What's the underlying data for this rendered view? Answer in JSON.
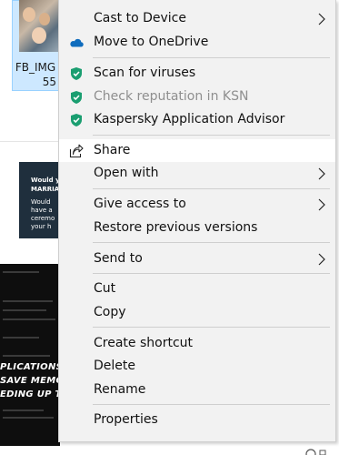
{
  "background": {
    "file1_name_line1": "FB_IMG",
    "file1_name_line2": "55",
    "thumb2_text": [
      "Would y",
      "MARRIA",
      "Would",
      "have a",
      "ceremo",
      "your h"
    ],
    "dark_panel_text": [
      "PLICATIONS F",
      "SAVE MEMOR",
      "EDING UP THE"
    ]
  },
  "context_menu": {
    "items": [
      {
        "label": "Cast to Device",
        "icon": "none",
        "submenu": true,
        "disabled": false
      },
      {
        "label": "Move to OneDrive",
        "icon": "onedrive-cloud-icon",
        "submenu": false,
        "disabled": false
      },
      {
        "label": "Scan for viruses",
        "icon": "kaspersky-shield-icon",
        "submenu": false,
        "disabled": false
      },
      {
        "label": "Check reputation in KSN",
        "icon": "kaspersky-shield-icon",
        "submenu": false,
        "disabled": true
      },
      {
        "label": "Kaspersky Application Advisor",
        "icon": "kaspersky-shield-icon",
        "submenu": false,
        "disabled": false
      },
      {
        "label": "Share",
        "icon": "share-icon",
        "submenu": false,
        "disabled": false,
        "highlighted": true
      },
      {
        "label": "Open with",
        "icon": "none",
        "submenu": true,
        "disabled": false
      },
      {
        "label": "Give access to",
        "icon": "none",
        "submenu": true,
        "disabled": false
      },
      {
        "label": "Restore previous versions",
        "icon": "none",
        "submenu": false,
        "disabled": false
      },
      {
        "label": "Send to",
        "icon": "none",
        "submenu": true,
        "disabled": false
      },
      {
        "label": "Cut",
        "icon": "none",
        "submenu": false,
        "disabled": false
      },
      {
        "label": "Copy",
        "icon": "none",
        "submenu": false,
        "disabled": false
      },
      {
        "label": "Create shortcut",
        "icon": "none",
        "submenu": false,
        "disabled": false
      },
      {
        "label": "Delete",
        "icon": "none",
        "submenu": false,
        "disabled": false
      },
      {
        "label": "Rename",
        "icon": "none",
        "submenu": false,
        "disabled": false
      },
      {
        "label": "Properties",
        "icon": "none",
        "submenu": false,
        "disabled": false
      }
    ]
  },
  "colors": {
    "menu_bg": "#f2f2f2",
    "highlight_bg": "#ffffff",
    "kaspersky_green": "#1a9e70",
    "onedrive_blue": "#0f6cbd",
    "disabled_text": "#8f8f8f"
  }
}
